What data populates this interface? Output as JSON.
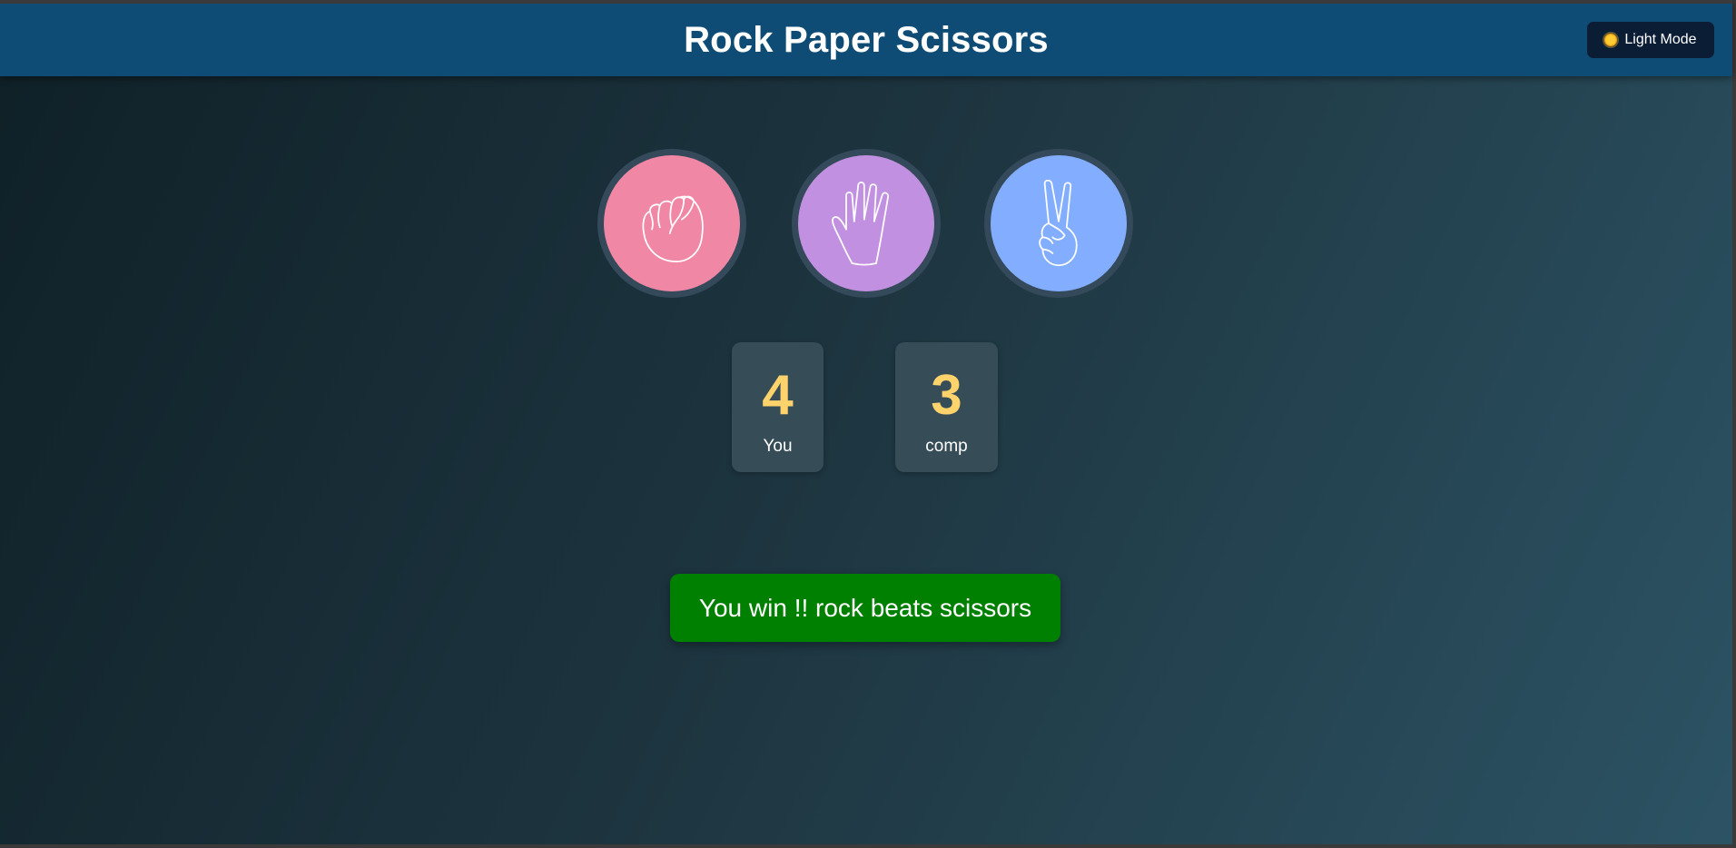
{
  "header": {
    "title": "Rock Paper Scissors",
    "mode_button_label": "Light Mode",
    "mode_icon": "sun-icon"
  },
  "choices": [
    {
      "id": "rock",
      "icon": "fist-icon",
      "color": "#f087a5"
    },
    {
      "id": "paper",
      "icon": "open-hand-icon",
      "color": "#c290e0"
    },
    {
      "id": "scissors",
      "icon": "peace-hand-icon",
      "color": "#83aeff"
    }
  ],
  "score": {
    "user_score": "4",
    "user_label": "You",
    "comp_score": "3",
    "comp_label": "comp"
  },
  "message": {
    "text": "You win !! rock beats scissors",
    "color": "#008000"
  }
}
